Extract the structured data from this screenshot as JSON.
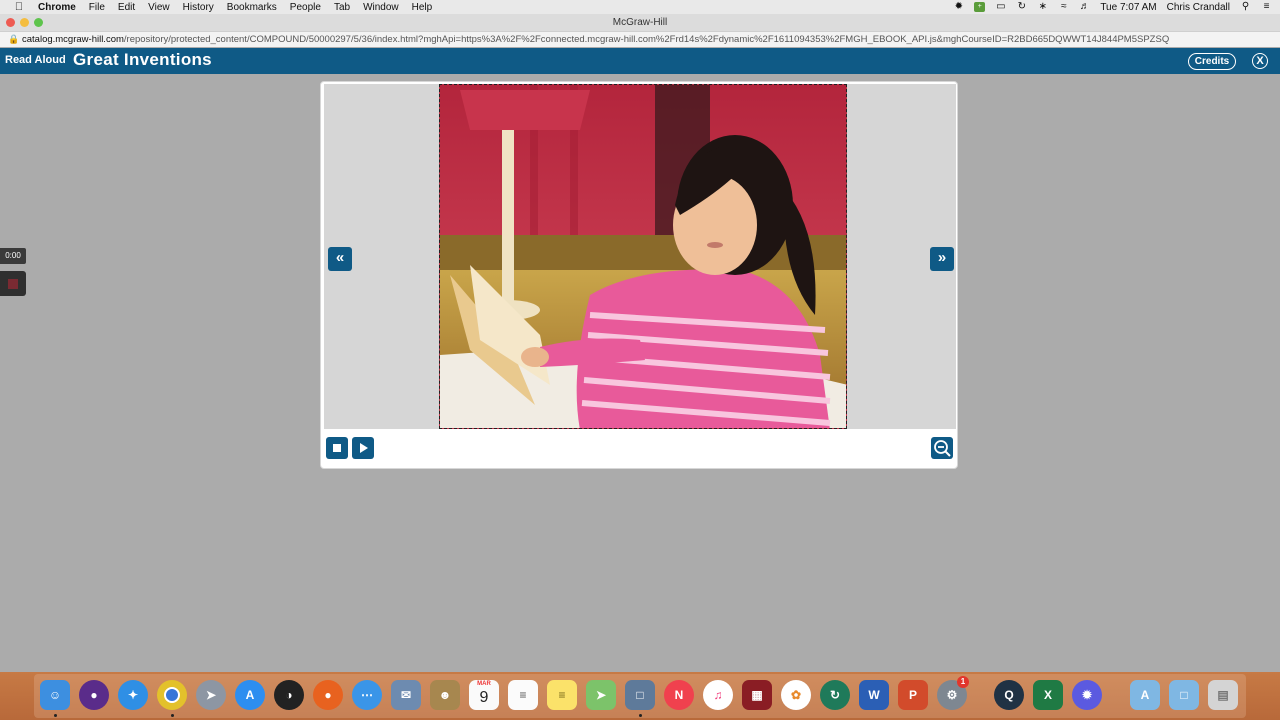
{
  "menubar": {
    "items": [
      "Chrome",
      "File",
      "Edit",
      "View",
      "History",
      "Bookmarks",
      "People",
      "Tab",
      "Window",
      "Help"
    ],
    "clock": "Tue 7:07 AM",
    "user": "Chris Crandall"
  },
  "window": {
    "title": "McGraw-Hill",
    "url_host": "catalog.mcgraw-hill.com",
    "url_path": "/repository/protected_content/COMPOUND/50000297/5/36/index.html?mghApi=https%3A%2F%2Fconnected.mcgraw-hill.com%2Frd14s%2Fdynamic%2F1611094353%2FMGH_EBOOK_API.js&mghCourseID=R2BD665DQWWT14J844PM5SPZSQ"
  },
  "app": {
    "mode_label": "Read Aloud",
    "title": "Great Inventions",
    "credits_label": "Credits",
    "close_label": "X"
  },
  "recorder": {
    "time": "0:00"
  },
  "viewer": {
    "prev_label": "«",
    "next_label": "»"
  },
  "dock": {
    "calendar_day": "9",
    "calendar_month": "MAR",
    "settings_badge": "1"
  },
  "colors": {
    "brand": "#0f5a86",
    "page_bg": "#ababab"
  }
}
